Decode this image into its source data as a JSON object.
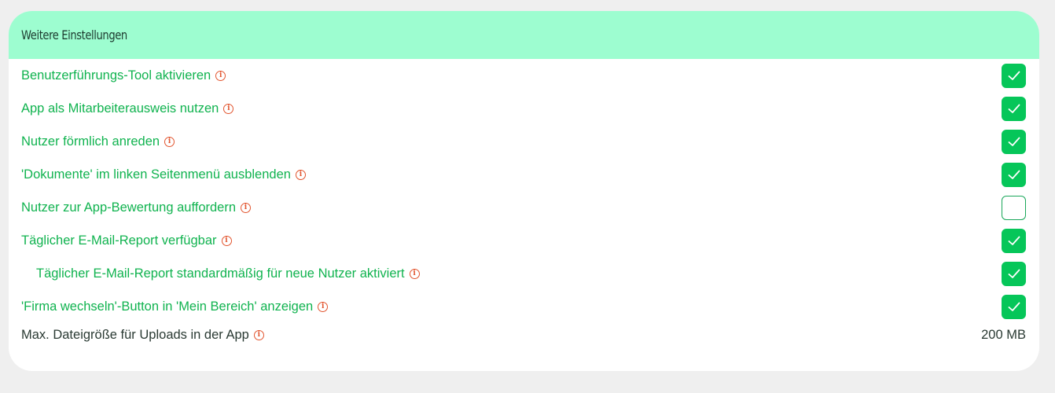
{
  "panel": {
    "title": "Weitere Einstellungen"
  },
  "settings": [
    {
      "label": "Benutzerführungs-Tool aktivieren",
      "checked": true,
      "indent": false
    },
    {
      "label": "App als Mitarbeiterausweis nutzen",
      "checked": true,
      "indent": false
    },
    {
      "label": "Nutzer förmlich anreden",
      "checked": true,
      "indent": false
    },
    {
      "label": "'Dokumente' im linken Seitenmenü ausblenden",
      "checked": true,
      "indent": false
    },
    {
      "label": "Nutzer zur App-Bewertung auffordern",
      "checked": false,
      "indent": false
    },
    {
      "label": "Täglicher E-Mail-Report verfügbar",
      "checked": true,
      "indent": false
    },
    {
      "label": "Täglicher E-Mail-Report standardmäßig für neue Nutzer aktiviert",
      "checked": true,
      "indent": true
    },
    {
      "label": "'Firma wechseln'-Button in 'Mein Bereich' anzeigen",
      "checked": true,
      "indent": false
    }
  ],
  "upload": {
    "label": "Max. Dateigröße für Uploads in der App",
    "value": "200 MB"
  },
  "icons": {
    "info": "info-icon",
    "check": "check-icon"
  },
  "colors": {
    "header_bg": "#9dfdd0",
    "label_green": "#10b34f",
    "checkbox_green": "#06c659",
    "info_red": "#e2552f"
  }
}
